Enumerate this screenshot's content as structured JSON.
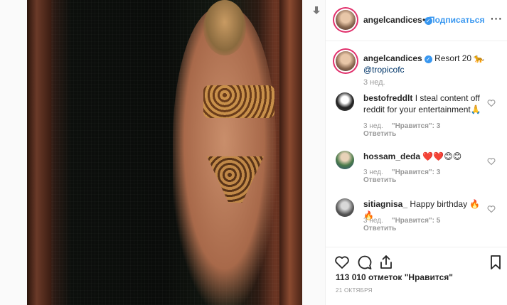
{
  "post": {
    "username": "angelcandices",
    "follow_separator": "•",
    "follow_label": "Подписаться",
    "more_label": "···"
  },
  "caption": {
    "username": "angelcandices",
    "text": "Resort 20 🐆",
    "mention": "@tropicofc",
    "time": "3 нед."
  },
  "comments": [
    {
      "username": "bestofreddlt",
      "text": "I steal content off reddit for your entertainment🙏",
      "time": "3 нед.",
      "likes": "\"Нравится\": 3",
      "reply": "Ответить"
    },
    {
      "username": "hossam_deda",
      "text": "❤️❤️😊😊",
      "time": "3 нед.",
      "likes": "\"Нравится\": 3",
      "reply": "Ответить"
    },
    {
      "username": "sitiagnisa_",
      "text": "Happy birthday 🔥🔥",
      "time": "3 нед.",
      "likes": "\"Нравится\": 5",
      "reply": "Ответить"
    }
  ],
  "stats": {
    "likes": "113 010 отметок \"Нравится\"",
    "date": "21 ОКТЯБРЯ"
  },
  "icons": {
    "download": "download-icon",
    "verified": "verified-badge-icon",
    "heart": "heart-icon",
    "comment": "comment-icon",
    "share": "share-icon",
    "bookmark": "bookmark-icon"
  },
  "colors": {
    "link_blue": "#3897f0",
    "mention_blue": "#003569",
    "muted": "#999999",
    "text": "#262626"
  }
}
